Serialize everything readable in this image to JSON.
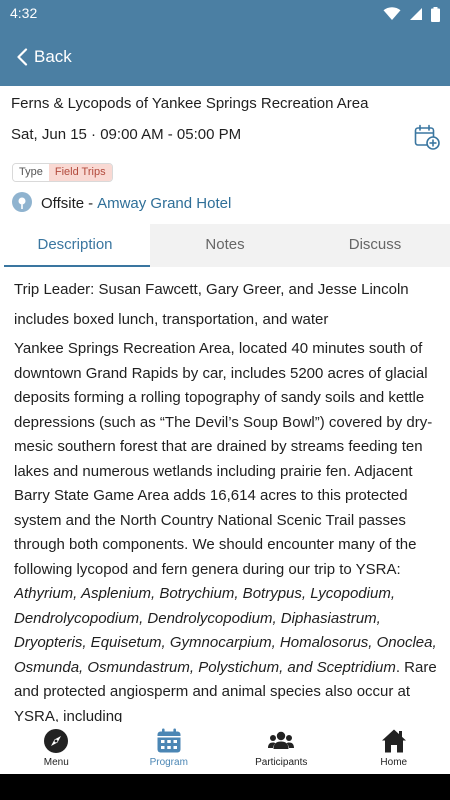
{
  "status_bar": {
    "time": "4:32",
    "icons": [
      "wifi-icon",
      "signal-icon",
      "battery-icon"
    ]
  },
  "header": {
    "back_label": "Back",
    "background_color": "#4b7fa3"
  },
  "event": {
    "title": "Ferns & Lycopods of Yankee Springs Recreation Area",
    "date": "Sat, Jun 15 · 09:00 AM - 05:00 PM",
    "type_label": "Type",
    "type_value": "Field Trips",
    "location_kind": "Offsite",
    "location_separator": "-",
    "location_name": "Amway Grand Hotel"
  },
  "tabs": [
    {
      "label": "Description",
      "active": true
    },
    {
      "label": "Notes",
      "active": false
    },
    {
      "label": "Discuss",
      "active": false
    }
  ],
  "description": {
    "line1": "Trip Leader: Susan Fawcett, Gary Greer, and Jesse Lincoln",
    "line2": "includes boxed lunch, transportation, and water",
    "para_intro": "Yankee Springs Recreation Area, located 40 minutes south of downtown Grand Rapids by car, includes 5200 acres of glacial deposits forming a rolling topography of sandy soils and kettle depressions (such as “The Devil’s Soup Bowl”) covered by dry-mesic southern forest that are drained by streams feeding ten lakes and numerous wetlands including prairie fen.  Adjacent Barry State Game Area adds 16,614 acres to this protected system and the North Country National Scenic Trail passes through both components.  We should encounter many of the following lycopod and fern genera during our trip to YSRA: ",
    "genera": "Athyrium, Asplenium, Botrychium, Botrypus, Lycopodium, Dendrolycopodium, Dendrolycopodium, Diphasiastrum, Dryopteris, Equisetum, Gymnocarpium, Homalosorus, Onoclea, Osmunda, Osmundastrum, Polystichum, and Sceptridium",
    "para_end": ".  Rare and protected angiosperm and animal species also occur at YSRA, including"
  },
  "bottom_nav": [
    {
      "label": "Menu",
      "icon": "compass-icon",
      "active": false
    },
    {
      "label": "Program",
      "icon": "calendar-icon",
      "active": true
    },
    {
      "label": "Participants",
      "icon": "people-icon",
      "active": false
    },
    {
      "label": "Home",
      "icon": "home-icon",
      "active": false
    }
  ],
  "colors": {
    "accent": "#3a76a0",
    "tag_background": "#f9d9d3",
    "tag_text": "#b24a3c"
  }
}
